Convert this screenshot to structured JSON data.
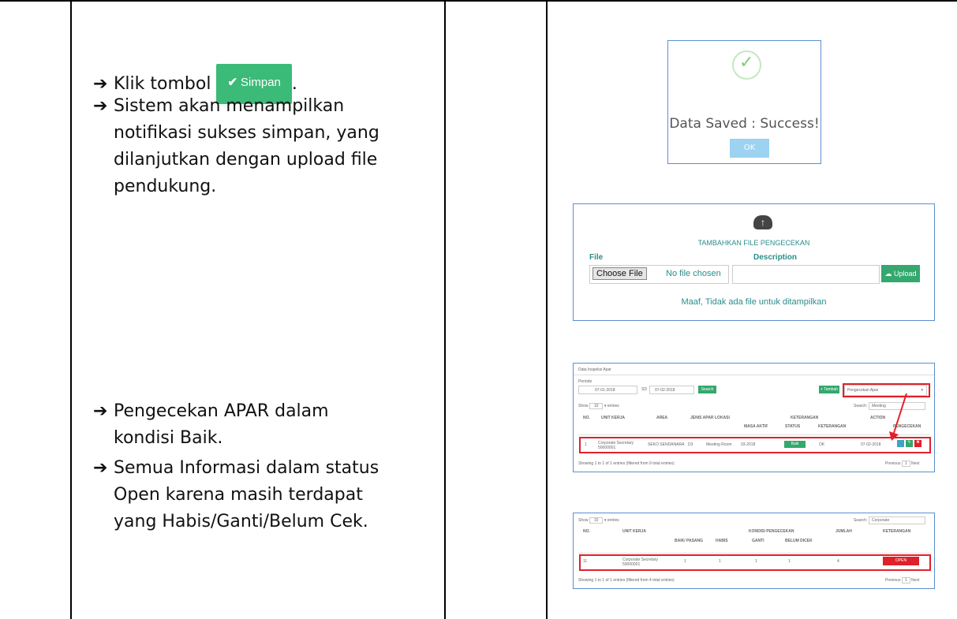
{
  "left_text": {
    "b1_prefix": "Klik tombol",
    "b1_suffix": ".",
    "simpan_button": "Simpan",
    "b2_lines": [
      "Sistem akan menampilkan",
      "notifikasi sukses simpan, yang",
      "dilanjutkan dengan upload file",
      "pendukung."
    ],
    "b3_lines": [
      "Pengecekan APAR dalam",
      "kondisi Baik."
    ],
    "b4_lines": [
      "Semua Informasi dalam status",
      "Open karena masih terdapat",
      "yang Habis/Ganti/Belum Cek."
    ]
  },
  "saved_dialog": {
    "message": "Data Saved : Success!",
    "ok": "OK"
  },
  "upload_panel": {
    "title": "TAMBAHKAN FILE PENGECEKAN",
    "file_label": "File",
    "description_label": "Description",
    "choose_file": "Choose File",
    "no_file": "No file chosen",
    "upload": "Upload",
    "empty_msg": "Maaf, Tidak ada file untuk ditampilkan"
  },
  "inspection_panel": {
    "title": "Data Inspeksi Apar",
    "periode_label": "Periode",
    "date_from": "07-01-2018",
    "sd": "SD",
    "date_to": "07-02-2018",
    "search_btn": "Search",
    "add_btn": "Tambah",
    "select_value": "Pengecekan Apar",
    "show": "Show",
    "entries_count": "10",
    "entries": "entries",
    "search_label": "Search:",
    "search_value": "Meeting",
    "headers": {
      "no": "NO.",
      "unit": "UNIT KERJA",
      "area": "AREA",
      "jenis": "JENIS APAR",
      "lokasi": "LOKASI",
      "keterangan": "KETERANGAN",
      "masa": "MASA AKTIF",
      "status": "STATUS",
      "ket2": "KETERANGAN",
      "action": "ACTION",
      "pengecekan": "PENGECEKAN"
    },
    "row": {
      "no": "1",
      "unit": "Corporate Secretary",
      "unit_code": "50000001",
      "area": "SEKO SENDANARA",
      "jenis": "D3",
      "lokasi": "Meeting Room",
      "masa": "03-2018",
      "status": "Baik",
      "ket": "OK",
      "tanggal": "07-02-2018"
    },
    "showing": "Showing 1 to 1 of 1 entries (filtered from 9 total entries)",
    "prev": "Previous",
    "page": "1",
    "next": "Next"
  },
  "summary_panel": {
    "show": "Show",
    "entries_count": "10",
    "entries": "entries",
    "search_label": "Search:",
    "search_value": "Corporate",
    "headers": {
      "no": "NO.",
      "unit": "UNIT KERJA",
      "kondisi": "KONDISI PENGECEKAN",
      "jumlah": "JUMLAH",
      "keterangan": "KETERANGAN",
      "baik": "BAIK/ PASANG",
      "habis": "HABIS",
      "ganti": "GANTI",
      "belum": "BELUM DICEK"
    },
    "row": {
      "no": "11",
      "unit": "Corporate Secretary",
      "unit_code": "50000001",
      "baik": "1",
      "habis": "1",
      "ganti": "1",
      "belum": "1",
      "jumlah": "4",
      "status": "OPEN"
    },
    "showing": "Showing 1 to 1 of 1 entries (filtered from 4 total entries)",
    "prev": "Previous",
    "page": "1",
    "next": "Next"
  },
  "colors": {
    "green": "#34a86e",
    "red": "#e0212a",
    "border": "#5a8fd0",
    "teal": "#2a8d8a"
  }
}
